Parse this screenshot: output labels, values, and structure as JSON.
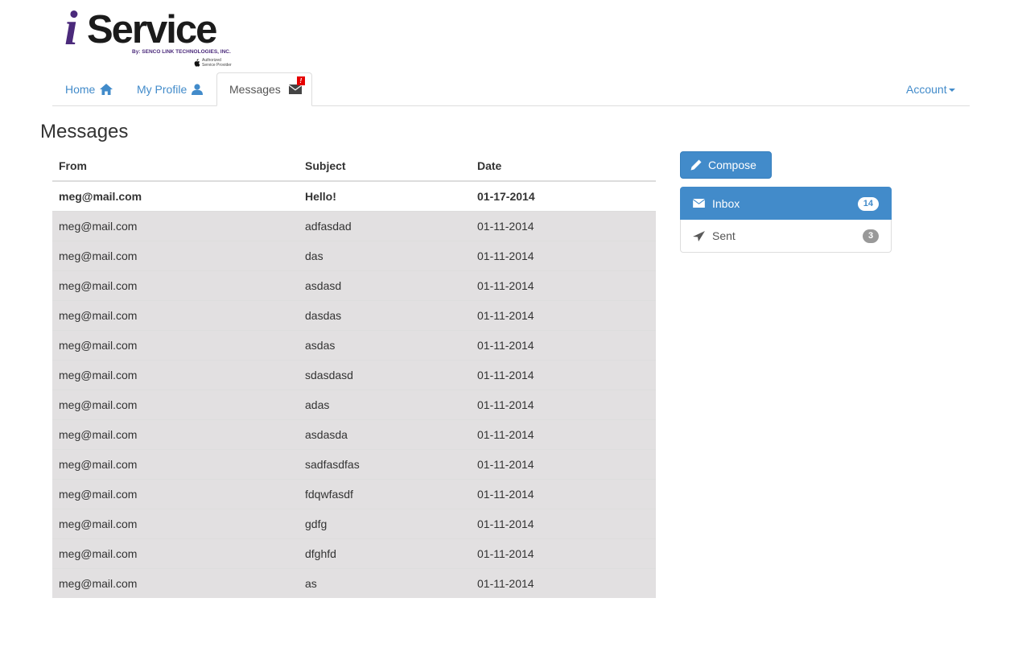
{
  "brand": {
    "logo_i": "i",
    "logo_word": "Service",
    "byline": "By: SENCO LINK TECHNOLOGIES, INC.",
    "badge_line1": "Authorized",
    "badge_line2": "Service Provider",
    "primary_color": "#4b2a7b"
  },
  "nav": {
    "home": "Home",
    "profile": "My Profile",
    "messages": "Messages",
    "messages_badge": "!",
    "account": "Account"
  },
  "page": {
    "title": "Messages"
  },
  "table": {
    "headers": {
      "from": "From",
      "subject": "Subject",
      "date": "Date"
    },
    "rows": [
      {
        "from": "meg@mail.com",
        "subject": "Hello!",
        "date": "01-17-2014",
        "unread": true
      },
      {
        "from": "meg@mail.com",
        "subject": "adfasdad",
        "date": "01-11-2014",
        "unread": false
      },
      {
        "from": "meg@mail.com",
        "subject": "das",
        "date": "01-11-2014",
        "unread": false
      },
      {
        "from": "meg@mail.com",
        "subject": "asdasd",
        "date": "01-11-2014",
        "unread": false
      },
      {
        "from": "meg@mail.com",
        "subject": "dasdas",
        "date": "01-11-2014",
        "unread": false
      },
      {
        "from": "meg@mail.com",
        "subject": "asdas",
        "date": "01-11-2014",
        "unread": false
      },
      {
        "from": "meg@mail.com",
        "subject": "sdasdasd",
        "date": "01-11-2014",
        "unread": false
      },
      {
        "from": "meg@mail.com",
        "subject": "adas",
        "date": "01-11-2014",
        "unread": false
      },
      {
        "from": "meg@mail.com",
        "subject": "asdasda",
        "date": "01-11-2014",
        "unread": false
      },
      {
        "from": "meg@mail.com",
        "subject": "sadfasdfas",
        "date": "01-11-2014",
        "unread": false
      },
      {
        "from": "meg@mail.com",
        "subject": "fdqwfasdf",
        "date": "01-11-2014",
        "unread": false
      },
      {
        "from": "meg@mail.com",
        "subject": "gdfg",
        "date": "01-11-2014",
        "unread": false
      },
      {
        "from": "meg@mail.com",
        "subject": "dfghfd",
        "date": "01-11-2014",
        "unread": false
      },
      {
        "from": "meg@mail.com",
        "subject": "as",
        "date": "01-11-2014",
        "unread": false
      }
    ]
  },
  "sidebar": {
    "compose": "Compose",
    "inbox": {
      "label": "Inbox",
      "count": "14"
    },
    "sent": {
      "label": "Sent",
      "count": "3"
    },
    "accent_color": "#428bca"
  },
  "icons": {
    "home": "home-icon",
    "profile": "user-icon",
    "messages": "envelope-icon",
    "compose": "pencil-icon",
    "inbox": "envelope-icon",
    "sent": "send-icon"
  }
}
